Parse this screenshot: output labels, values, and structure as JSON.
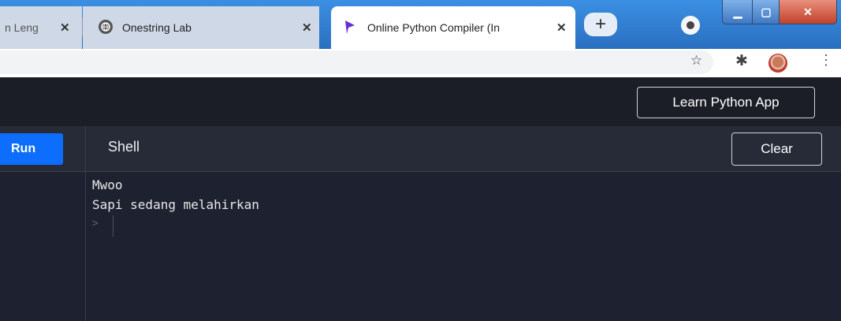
{
  "browser": {
    "tabs": [
      {
        "title": "n Leng",
        "active": false
      },
      {
        "title": "Onestring Lab",
        "active": false
      },
      {
        "title": "Online Python Compiler (In",
        "active": true
      }
    ],
    "tab_close_glyph": "✕",
    "new_tab_glyph": "+",
    "window_controls": {
      "minimize": "▁",
      "maximize": "▢",
      "close": "✕"
    },
    "toolbar_icons": {
      "star": "☆",
      "extensions": "✱",
      "menu": "⋮"
    }
  },
  "app": {
    "learn_button": "Learn Python App",
    "run_button": "Run",
    "shell_title": "Shell",
    "clear_button": "Clear"
  },
  "shell": {
    "output_lines": [
      "Mwoo",
      "Sapi sedang melahirkan"
    ],
    "prompt_glyph": ">"
  },
  "colors": {
    "run_button": "#0d6efd",
    "app_bg": "#1e2230",
    "header_bg": "#1b1e27",
    "shellbar_bg": "#272b38"
  }
}
